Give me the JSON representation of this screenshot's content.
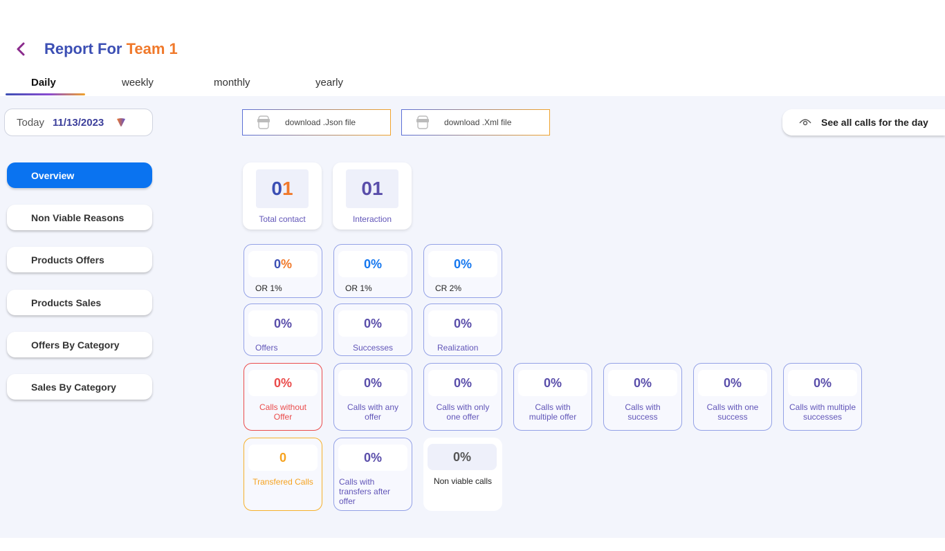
{
  "header": {
    "title_part1": "Report For",
    "title_part2": "Team 1"
  },
  "tabs": [
    {
      "label": "Daily",
      "active": true
    },
    {
      "label": "weekly",
      "active": false
    },
    {
      "label": "monthly",
      "active": false
    },
    {
      "label": "yearly",
      "active": false
    }
  ],
  "date_picker": {
    "label": "Today",
    "value": "11/13/2023"
  },
  "downloads": {
    "json_label": "download .Json file",
    "xml_label": "download .Xml file"
  },
  "see_all_label": "See all calls for the day",
  "menu": [
    {
      "label": "Overview",
      "active": true
    },
    {
      "label": "Non Viable Reasons",
      "active": false
    },
    {
      "label": "Products Offers",
      "active": false
    },
    {
      "label": "Products Sales",
      "active": false
    },
    {
      "label": "Offers By Category",
      "active": false
    },
    {
      "label": "Sales By Category",
      "active": false
    }
  ],
  "summary": {
    "total_contact": {
      "value_a": "0",
      "value_b": "1",
      "label": "Total contact"
    },
    "interaction": {
      "value": "01",
      "label": "Interaction"
    }
  },
  "rates": [
    {
      "value_a": "0",
      "value_b": "%",
      "label": "OR 1%"
    },
    {
      "value": "0%",
      "label": "OR 1%"
    },
    {
      "value": "0%",
      "label": "CR 2%"
    }
  ],
  "totals": [
    {
      "value": "0%",
      "label": "Offers"
    },
    {
      "value": "0%",
      "label": "Successes"
    },
    {
      "value": "0%",
      "label": "Realization"
    }
  ],
  "calls": [
    {
      "value": "0%",
      "label": "Calls without Offer"
    },
    {
      "value": "0%",
      "label": "Calls with any offer"
    },
    {
      "value": "0%",
      "label": "Calls with only one offer"
    },
    {
      "value": "0%",
      "label": "Calls with multiple offer"
    },
    {
      "value": "0%",
      "label": "Calls with success"
    },
    {
      "value": "0%",
      "label": "Calls with one success"
    },
    {
      "value": "0%",
      "label": "Calls with multiple successes"
    }
  ],
  "transfers": [
    {
      "value": "0",
      "label": "Transfered Calls"
    },
    {
      "value": "0%",
      "label": "Calls with transfers after offer"
    },
    {
      "value": "0%",
      "label": "Non viable calls"
    }
  ],
  "colors": {
    "brand_blue": "#3c4fb4",
    "brand_orange": "#f0792b",
    "active_menu": "#0a73f0",
    "panel_bg": "#f3f5fc",
    "alert_red": "#ea4b4b",
    "amber": "#f6a21e"
  }
}
